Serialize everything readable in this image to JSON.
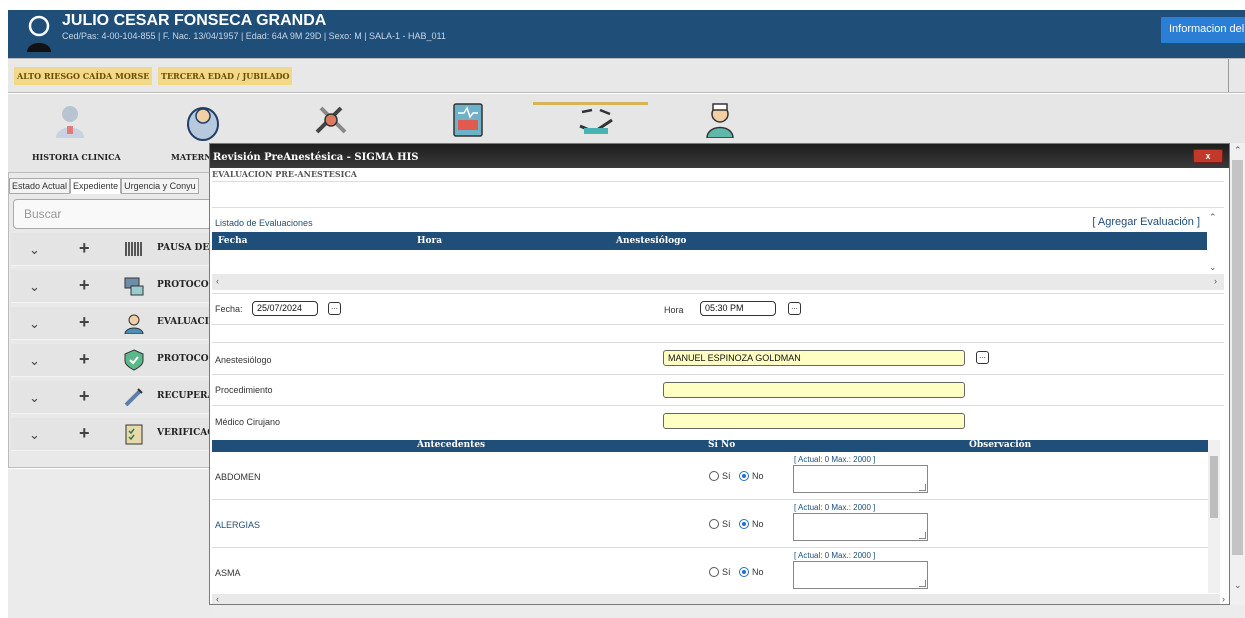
{
  "patient": {
    "name": "JULIO CESAR FONSECA GRANDA",
    "info": "Ced/Pas: 4-00-104-855 | F. Nac. 13/04/1957 | Edad: 64A 9M 29D | Sexo: M  | SALA-1  - HAB_011",
    "info_button": "Informacion del"
  },
  "alerts": [
    "ALTO RIESGO CAÍDA MORSE",
    "TERCERA EDAD / JUBILADO"
  ],
  "toolbar": {
    "items": [
      {
        "label": "HISTORIA CLINICA",
        "icon": "doctor-icon"
      },
      {
        "label": "MATERN",
        "icon": "baby-icon"
      },
      {
        "label": "",
        "icon": "surgery-tools-icon"
      },
      {
        "label": "",
        "icon": "monitor-icon"
      },
      {
        "label": "",
        "icon": "anesthesia-icon"
      },
      {
        "label": "",
        "icon": "nurse-icon"
      }
    ]
  },
  "leftpanel": {
    "tabs": [
      "Estado Actual",
      "Expediente",
      "Urgencia y Conyu"
    ],
    "search_placeholder": "Buscar",
    "rows": [
      {
        "label": "PAUSA DE S",
        "icon": "barcode-icon"
      },
      {
        "label": "PROTOCOL",
        "icon": "protocol-icon"
      },
      {
        "label": "EVALUACIO",
        "icon": "doctor-icon"
      },
      {
        "label": "PROTOCOL",
        "icon": "shield-icon"
      },
      {
        "label": "RECUPERA",
        "icon": "syringe-icon"
      },
      {
        "label": "VERIFICAC",
        "icon": "checklist-icon"
      }
    ]
  },
  "modal": {
    "title": "Revisión PreAnestésica - SIGMA HIS",
    "close_label": "x",
    "subheading": "EVALUACION PRE-ANESTESICA",
    "list_label": "Listado de Evaluaciones",
    "add_link": "[ Agregar Evaluación ]",
    "grid_headers": [
      "Fecha",
      "Hora",
      "Anestesiólogo"
    ],
    "fecha_label": "Fecha:",
    "fecha_value": "25/07/2024",
    "hora_label": "Hora",
    "hora_value": "05:30 PM",
    "dots": "...",
    "anestesiologo_label": "Anestesiólogo",
    "anestesiologo_value": "MANUEL ESPINOZA GOLDMAN",
    "procedimiento_label": "Procedimiento",
    "cirujano_label": "Médico Cirujano",
    "ant_headers": {
      "antecedentes": "Antecedentes",
      "si_no": "Sí   No",
      "observacion": "Observación"
    },
    "si_label": "Sí",
    "no_label": "No",
    "counter": "[ Actual: 0   Max.: 2000 ]",
    "antecedentes": [
      {
        "name": "ABDOMEN",
        "selected": "No"
      },
      {
        "name": "ALERGIAS",
        "selected": "No"
      },
      {
        "name": "ASMA",
        "selected": "No"
      }
    ]
  },
  "colors": {
    "header": "#1f4e79",
    "accent": "#2a7fd4",
    "badge": "#f2d98a",
    "highlight": "#ffffc4"
  }
}
